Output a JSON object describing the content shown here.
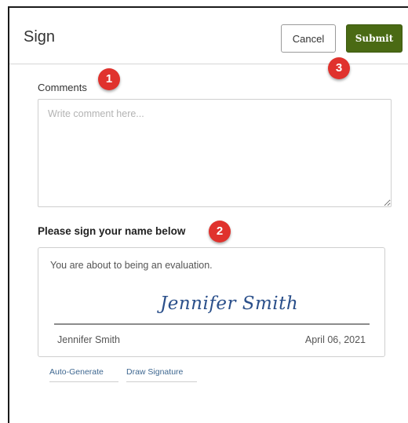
{
  "header": {
    "title": "Sign",
    "cancel_label": "Cancel",
    "submit_label": "Submit"
  },
  "comments": {
    "label": "Comments",
    "placeholder": "Write comment here...",
    "value": ""
  },
  "signature": {
    "heading": "Please sign your name below",
    "notice": "You are about to being an evaluation.",
    "signature_text": "Jennifer Smith",
    "signer_name": "Jennifer Smith",
    "date": "April 06, 2021",
    "tabs": [
      "Auto-Generate",
      "Draw Signature"
    ]
  },
  "callouts": [
    "1",
    "2",
    "3"
  ],
  "colors": {
    "submit_bg": "#4a6a14",
    "callout_bg": "#e0322d",
    "signature_ink": "#2a4f8a",
    "link": "#3e6790"
  }
}
